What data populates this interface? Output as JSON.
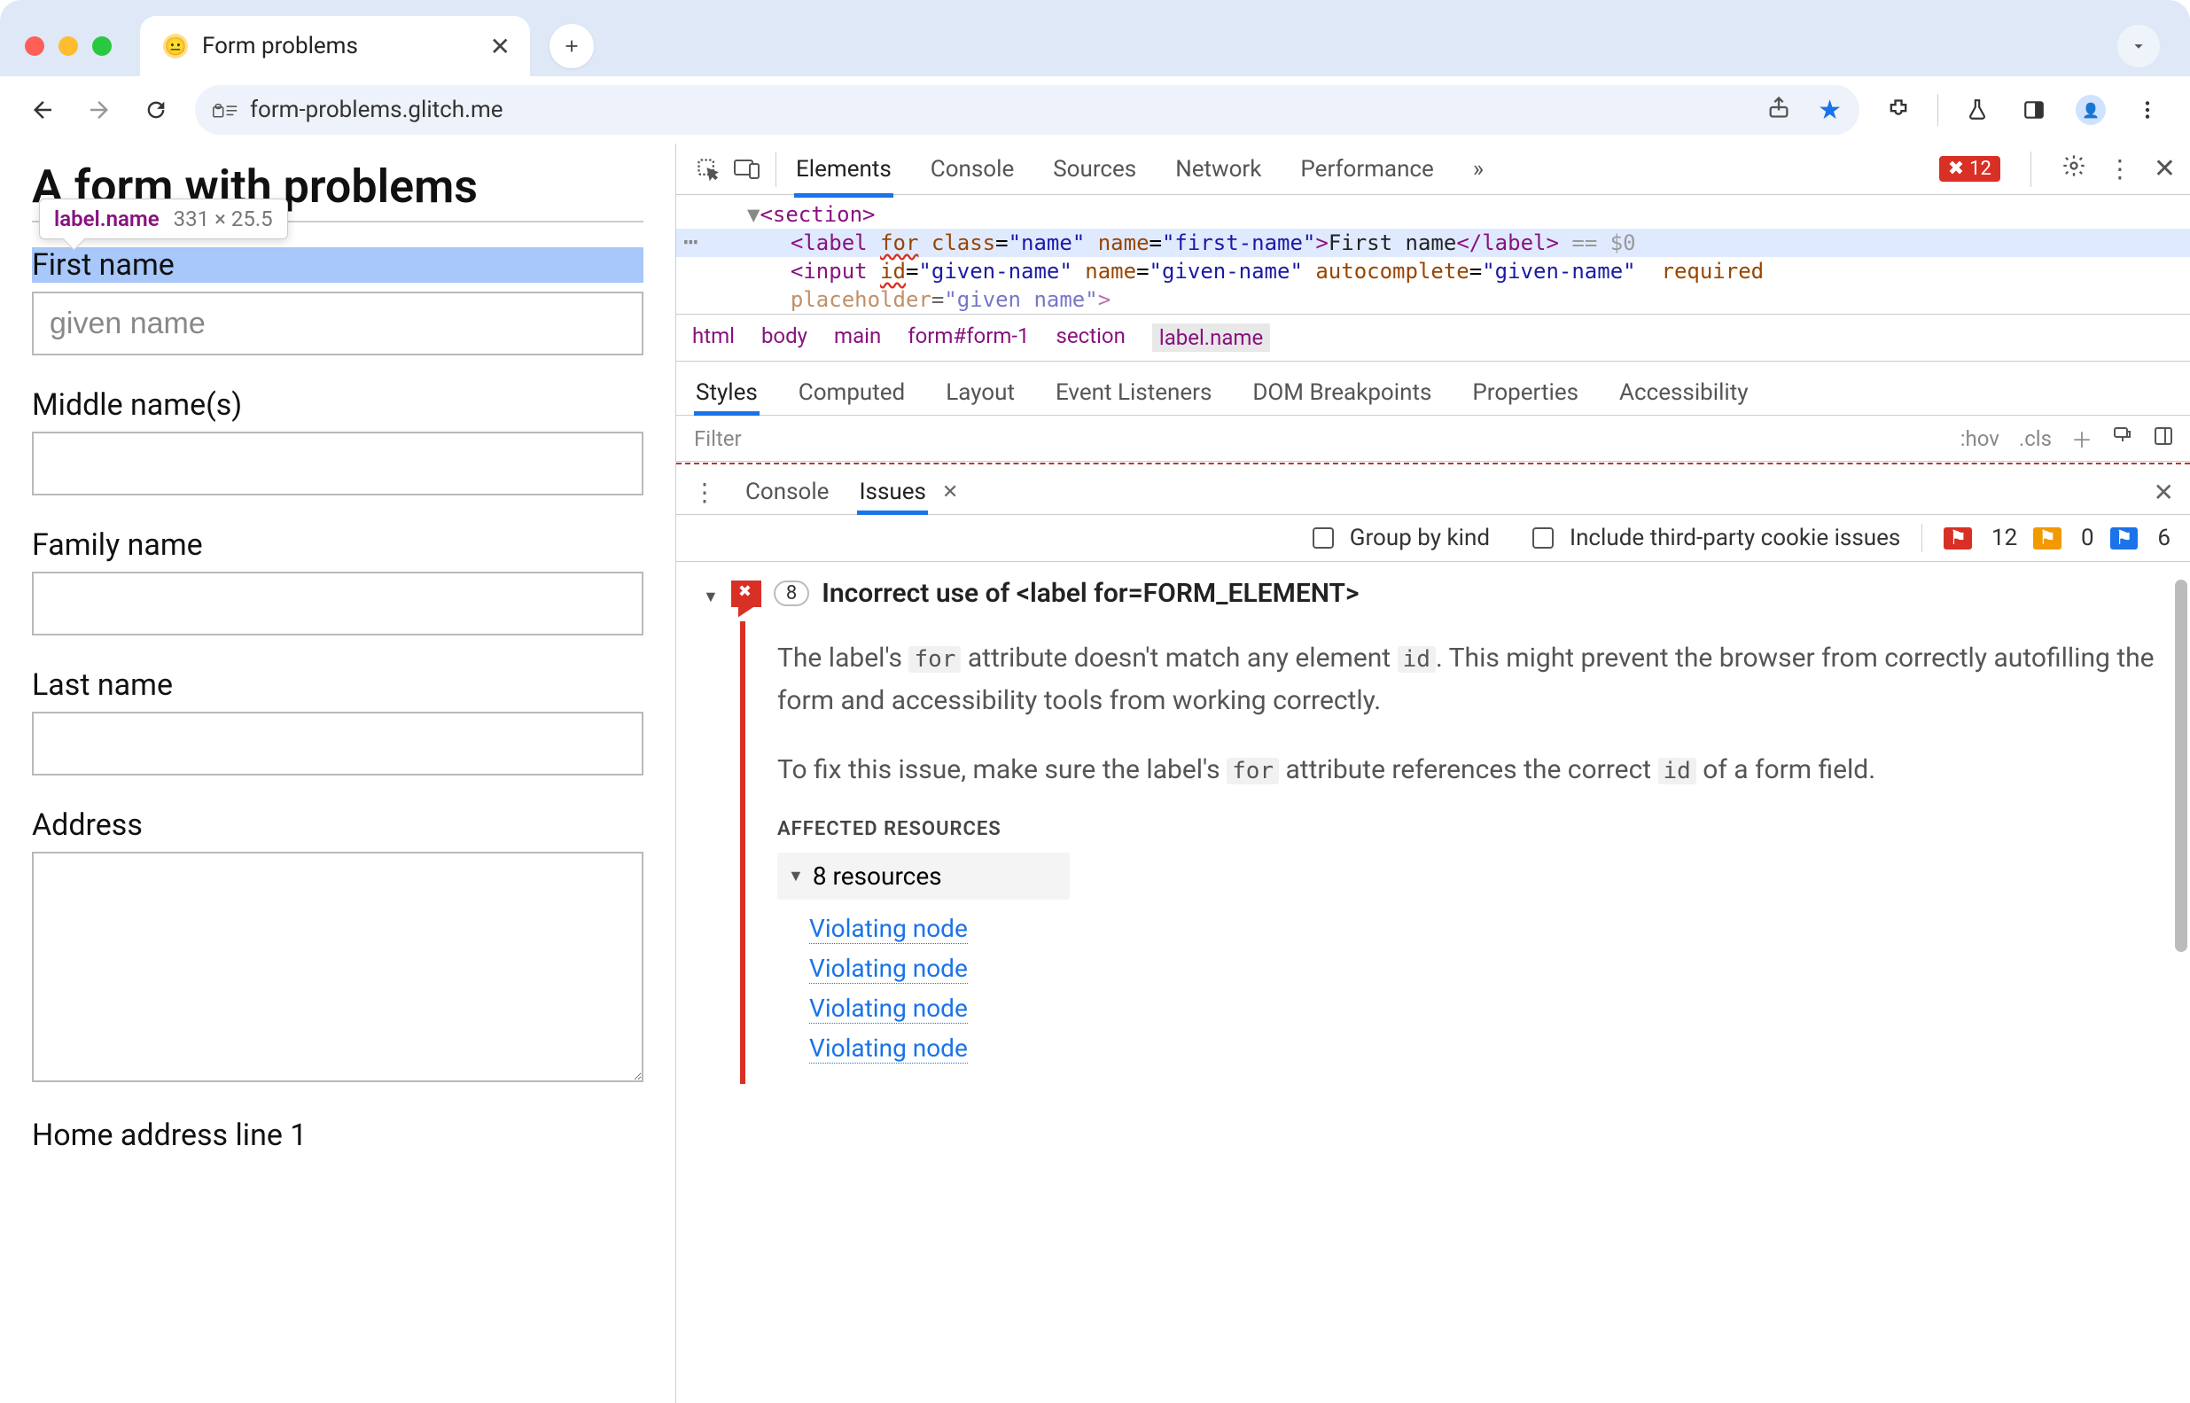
{
  "chrome": {
    "tab_title": "Form problems",
    "url": "form-problems.glitch.me"
  },
  "page": {
    "heading": "A form with problems",
    "tooltip_selector": "label.name",
    "tooltip_dim": "331 × 25.5",
    "labels": {
      "first": "First name",
      "first_placeholder": "given name",
      "middle": "Middle name(s)",
      "family": "Family name",
      "last": "Last name",
      "address": "Address",
      "home1": "Home address line 1"
    }
  },
  "devtools": {
    "top_tabs": [
      "Elements",
      "Console",
      "Sources",
      "Network",
      "Performance"
    ],
    "top_errors": "12",
    "dom": {
      "line1": "<section>",
      "line2_open": "<label",
      "line2_for": "for",
      "line2_class_k": "class",
      "line2_class_v": "\"name\"",
      "line2_name_k": "name",
      "line2_name_v": "\"first-name\"",
      "line2_close": ">",
      "line2_text": "First name",
      "line2_end": "</label>",
      "line2_eq": "== $0",
      "line3_open": "<input",
      "line3_id_k": "id",
      "line3_id_v": "\"given-name\"",
      "line3_name_k": "name",
      "line3_name_v": "\"given-name\"",
      "line3_ac_k": "autocomplete",
      "line3_ac_v": "\"given-name\"",
      "line3_req": "required",
      "line4_ph_k": "placeholder",
      "line4_ph_v": "\"given name\""
    },
    "breadcrumb": [
      "html",
      "body",
      "main",
      "form#form-1",
      "section",
      "label.name"
    ],
    "style_tabs": [
      "Styles",
      "Computed",
      "Layout",
      "Event Listeners",
      "DOM Breakpoints",
      "Properties",
      "Accessibility"
    ],
    "filter_placeholder": "Filter",
    "hov": ":hov",
    "cls": ".cls",
    "drawer_tabs": {
      "console": "Console",
      "issues": "Issues"
    },
    "issues_toolbar": {
      "group": "Group by kind",
      "tp": "Include third-party cookie issues",
      "red": "12",
      "yel": "0",
      "blue": "6"
    },
    "issue": {
      "count": "8",
      "title": "Incorrect use of <label for=FORM_ELEMENT>",
      "p1a": "The label's ",
      "p1b": "for",
      "p1c": " attribute doesn't match any element ",
      "p1d": "id",
      "p1e": ". This might prevent the browser from correctly autofilling the form and accessibility tools from working correctly.",
      "p2a": "To fix this issue, make sure the label's ",
      "p2b": "for",
      "p2c": " attribute references the correct ",
      "p2d": "id",
      "p2e": " of a form field.",
      "aff": "AFFECTED RESOURCES",
      "res": "8 resources",
      "link": "Violating node"
    }
  }
}
